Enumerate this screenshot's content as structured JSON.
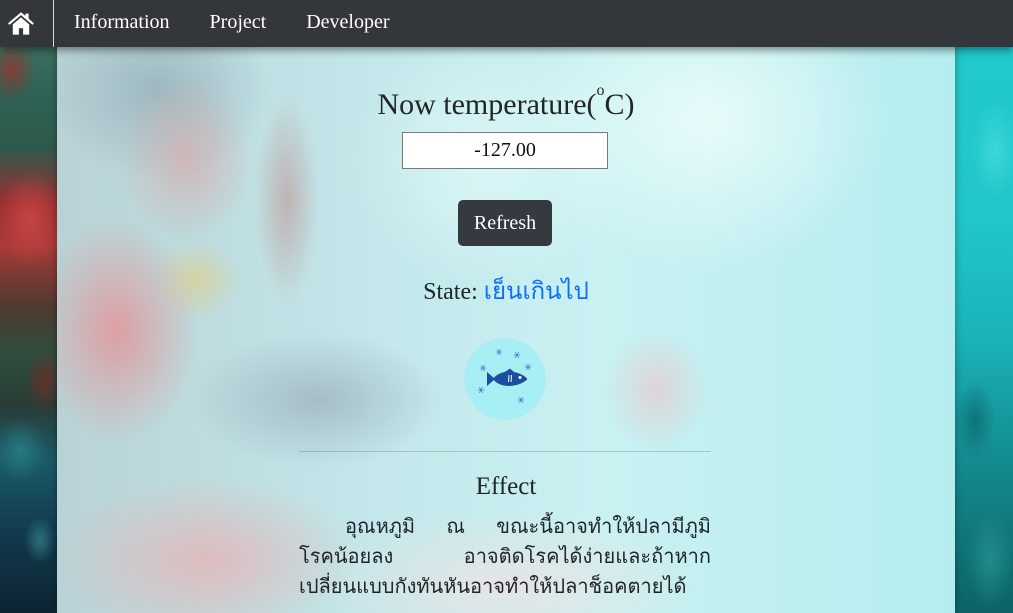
{
  "nav": {
    "home_icon": "home-icon",
    "items": [
      "Information",
      "Project",
      "Developer"
    ]
  },
  "temperature": {
    "heading_text": "Now temperature(",
    "heading_degree": "o",
    "heading_unit": "C)",
    "value": "-127.00"
  },
  "refresh": {
    "label": "Refresh"
  },
  "state": {
    "label": "State:",
    "value": "เย็นเกินไป",
    "icon": "cold-fish-icon"
  },
  "effect": {
    "heading": "Effect",
    "lines": [
      "อุณหภูมิ ณ ขณะนี้อาจทำให้ปลามีภูมิต้านทาน",
      "โรคน้อยลง อาจติดโรคได้ง่ายและถ้าหากอุณหภูมิ",
      "เปลี่ยนแบบกังทันหันอาจทำให้ปลาช็อคตายได้"
    ]
  },
  "colors": {
    "navbar": "#33373c",
    "button": "#343a40",
    "state_accent": "#0d6efd",
    "icon_circle": "#a8eef5",
    "fish": "#1b4f9e",
    "text": "#212529"
  }
}
